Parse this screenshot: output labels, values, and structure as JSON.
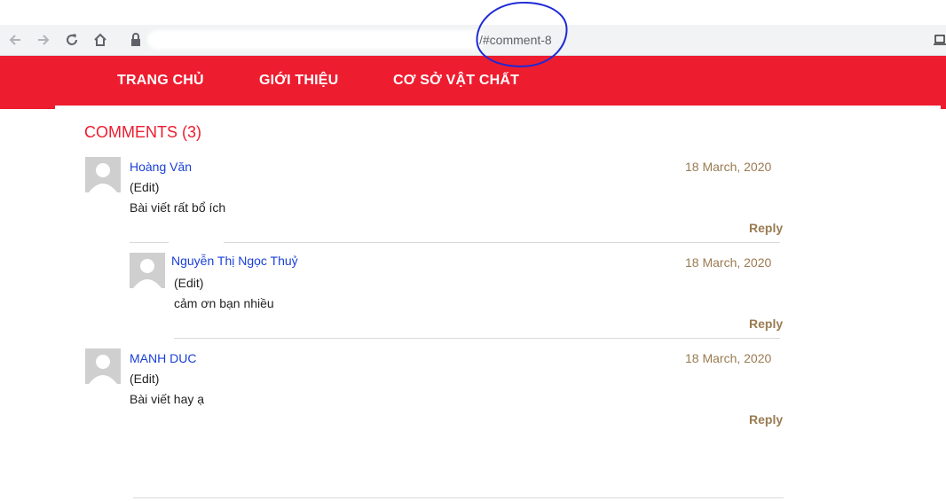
{
  "browser": {
    "url_visible": "/#comment-8"
  },
  "site_nav": {
    "items": [
      "TRANG CHỦ",
      "GIỚI THIỆU",
      "CƠ SỞ VẬT CHẤT"
    ]
  },
  "comments_section": {
    "title": "COMMENTS (3)",
    "comments": [
      {
        "author": "Hoàng Văn",
        "edit_label": "(Edit)",
        "date": "18 March, 2020",
        "text": "Bài viết rất bổ ích",
        "reply_label": "Reply"
      },
      {
        "author": "Nguyễn Thị Ngọc Thuỷ",
        "edit_label": "(Edit)",
        "date": "18 March, 2020",
        "text": "cảm ơn bạn nhiều",
        "reply_label": "Reply"
      },
      {
        "author": "MANH DUC",
        "edit_label": "(Edit)",
        "date": "18 March, 2020",
        "text": "Bài viết hay ạ",
        "reply_label": "Reply"
      }
    ]
  },
  "colors": {
    "nav_bg": "#ee1c2f",
    "title": "#ee1c2f",
    "author": "#1a3fd6",
    "date_reply": "#9a7b52",
    "annotation": "#1c2ad6"
  }
}
